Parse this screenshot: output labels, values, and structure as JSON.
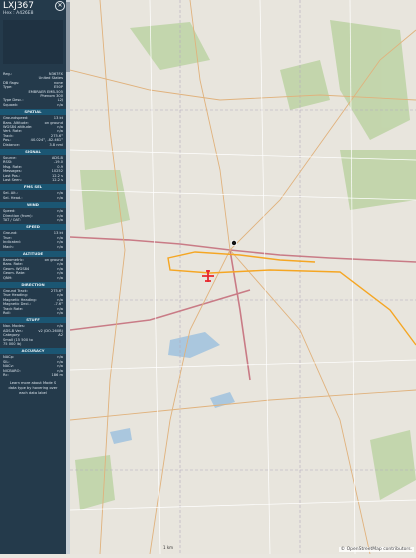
{
  "header": {
    "callsign": "LXJ367",
    "hex_label": "Hex :",
    "hex": "A426E8",
    "close_icon": "close-icon"
  },
  "registration": [
    {
      "k": "Reg.:",
      "v": "N367FX"
    },
    {
      "k": "",
      "v": "United States"
    },
    {
      "k": "DB flags:",
      "v": "none"
    },
    {
      "k": "Type:",
      "v": "E50P"
    },
    {
      "k": "",
      "v": "EMBRAER EMB-505"
    },
    {
      "k": "",
      "v": "Phenom 300"
    },
    {
      "k": "Type Desc.:",
      "v": "L2J"
    },
    {
      "k": "Squawk:",
      "v": "n/a"
    }
  ],
  "sections": {
    "spatial": "SPATIAL",
    "signal": "SIGNAL",
    "fms": "FMS SEL",
    "wind": "WIND",
    "speed": "SPEED",
    "altitude": "ALTITUDE",
    "direction": "DIRECTION",
    "stuff": "STUFF",
    "accuracy": "ACCURACY"
  },
  "spatial": [
    {
      "k": "Groundspeed:",
      "v": "13 kt"
    },
    {
      "k": "Baro. Altitude:",
      "v": "on ground"
    },
    {
      "k": "WGS84 altitude:",
      "v": "n/a"
    },
    {
      "k": "Vert. Rate:",
      "v": "n/a"
    },
    {
      "k": "Track:",
      "v": "275.6°"
    },
    {
      "k": "Pos.:",
      "v": "40.024°, -82.461°"
    },
    {
      "k": "Distance:",
      "v": "3.8 nmi"
    }
  ],
  "signal": [
    {
      "k": "Source:",
      "v": "ADS-B"
    },
    {
      "k": "RSSI:",
      "v": "-19.0"
    },
    {
      "k": "Msg. Rate:",
      "v": "0.9"
    },
    {
      "k": "Messages:",
      "v": "10252"
    },
    {
      "k": "Last Pos.:",
      "v": "12.2 s"
    },
    {
      "k": "Last Seen:",
      "v": "12.2 s"
    }
  ],
  "fms": [
    {
      "k": "Sel. Alt.:",
      "v": "n/a"
    },
    {
      "k": "Sel. Head.:",
      "v": "n/a"
    }
  ],
  "wind": [
    {
      "k": "Speed:",
      "v": "n/a"
    },
    {
      "k": "Direction (from):",
      "v": "n/a"
    },
    {
      "k": "TAT / OAT:",
      "v": "n/a"
    }
  ],
  "speed": [
    {
      "k": "Ground:",
      "v": "13 kt"
    },
    {
      "k": "True:",
      "v": "n/a"
    },
    {
      "k": "Indicated:",
      "v": "n/a"
    },
    {
      "k": "Mach:",
      "v": "n/a"
    }
  ],
  "altitude": [
    {
      "k": "Barometric:",
      "v": "on ground"
    },
    {
      "k": "Baro. Rate:",
      "v": "n/a"
    },
    {
      "k": "Geom. WGS84",
      "v": "n/a"
    },
    {
      "k": "Geom. Rate:",
      "v": "n/a"
    },
    {
      "k": "QNH:",
      "v": "n/a"
    }
  ],
  "direction": [
    {
      "k": "Ground Track:",
      "v": "275.6°"
    },
    {
      "k": "True Heading:",
      "v": "n/a"
    },
    {
      "k": "Magnetic Heading:",
      "v": "n/a"
    },
    {
      "k": "Magnetic Decl.:",
      "v": "-7.6°"
    },
    {
      "k": "Track Rate:",
      "v": "n/a"
    },
    {
      "k": "Roll:",
      "v": "n/a"
    }
  ],
  "stuff": [
    {
      "k": "Nav. Modes:",
      "v": "n/a"
    },
    {
      "k": "ADS-B Ver.:",
      "v": "v2 (DO-260B)"
    },
    {
      "k": "Category:",
      "v": "A2"
    },
    {
      "k": "Small (15 500 to",
      "v": ""
    },
    {
      "k": "75 000 lb)",
      "v": ""
    }
  ],
  "accuracy": [
    {
      "k": "NACp:",
      "v": "n/a"
    },
    {
      "k": "SIL:",
      "v": "n/a"
    },
    {
      "k": "NACv:",
      "v": "n/a"
    },
    {
      "k": "NICBARO:",
      "v": "n/a"
    },
    {
      "k": "Rc:",
      "v": "186 m"
    }
  ],
  "footer": [
    "Learn more about Mode S",
    "data type by hovering over",
    "each data label"
  ],
  "map": {
    "attribution": "© OpenStreetMap contributors.",
    "scale_label": "1 km",
    "track_color": "#f5a623",
    "aircraft_color": "#e8262c",
    "receiver_icon": "receiver-dot-icon",
    "aircraft_icon": "aircraft-icon"
  }
}
